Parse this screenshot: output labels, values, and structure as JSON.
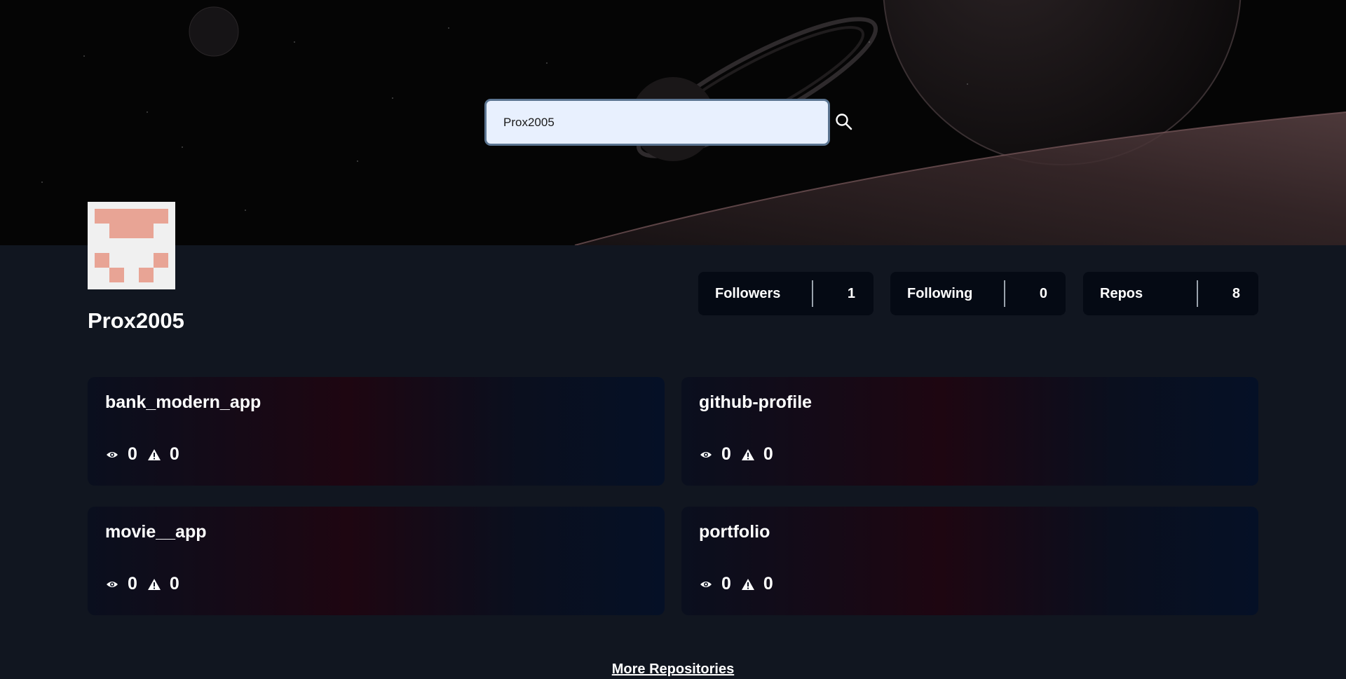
{
  "search": {
    "value": "Prox2005",
    "placeholder": ""
  },
  "profile": {
    "username": "Prox2005"
  },
  "stats": [
    {
      "label": "Followers",
      "value": "1"
    },
    {
      "label": "Following",
      "value": "0"
    },
    {
      "label": "Repos",
      "value": "8"
    }
  ],
  "repos": [
    {
      "name": "bank_modern_app",
      "watchers": "0",
      "issues": "0"
    },
    {
      "name": "github-profile",
      "watchers": "0",
      "issues": "0"
    },
    {
      "name": "movie__app",
      "watchers": "0",
      "issues": "0"
    },
    {
      "name": "portfolio",
      "watchers": "0",
      "issues": "0"
    }
  ],
  "more_label": "More Repositories",
  "icons": {
    "search": "search-icon",
    "watchers": "eye-icon",
    "issues": "warning-triangle-icon"
  },
  "colors": {
    "page_bg": "#111620",
    "card_bg": "#050a14",
    "search_bg": "#e8f0fe",
    "avatar_tile": "#e8a495"
  }
}
